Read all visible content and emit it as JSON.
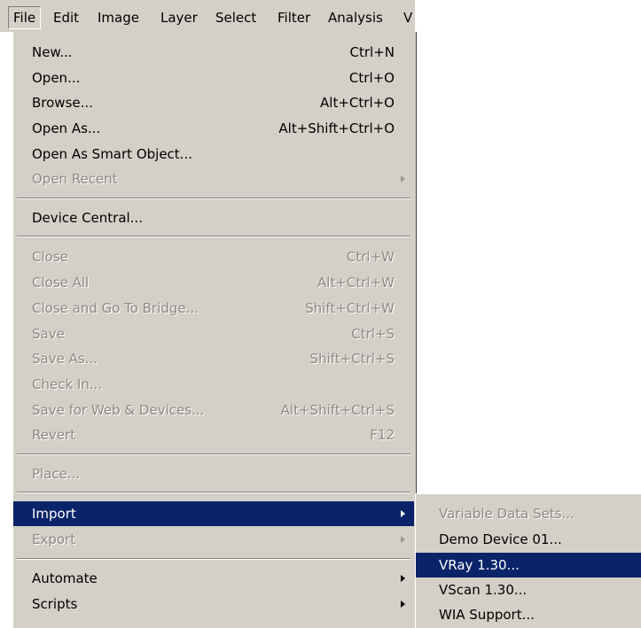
{
  "menubar": {
    "items": [
      "File",
      "Edit",
      "Image",
      "Layer",
      "Select",
      "Filter",
      "Analysis",
      "V"
    ]
  },
  "file_menu": {
    "items": [
      {
        "label": "New...",
        "shortcut": "Ctrl+N",
        "enabled": true
      },
      {
        "label": "Open...",
        "shortcut": "Ctrl+O",
        "enabled": true
      },
      {
        "label": "Browse...",
        "shortcut": "Alt+Ctrl+O",
        "enabled": true
      },
      {
        "label": "Open As...",
        "shortcut": "Alt+Shift+Ctrl+O",
        "enabled": true
      },
      {
        "label": "Open As Smart Object...",
        "shortcut": "",
        "enabled": true
      },
      {
        "label": "Open Recent",
        "shortcut": "",
        "enabled": false,
        "submenu": true
      },
      {
        "label": "Device Central...",
        "shortcut": "",
        "enabled": true
      },
      {
        "label": "Close",
        "shortcut": "Ctrl+W",
        "enabled": false
      },
      {
        "label": "Close All",
        "shortcut": "Alt+Ctrl+W",
        "enabled": false
      },
      {
        "label": "Close and Go To Bridge...",
        "shortcut": "Shift+Ctrl+W",
        "enabled": false
      },
      {
        "label": "Save",
        "shortcut": "Ctrl+S",
        "enabled": false
      },
      {
        "label": "Save As...",
        "shortcut": "Shift+Ctrl+S",
        "enabled": false
      },
      {
        "label": "Check In...",
        "shortcut": "",
        "enabled": false
      },
      {
        "label": "Save for Web & Devices...",
        "shortcut": "Alt+Shift+Ctrl+S",
        "enabled": false
      },
      {
        "label": "Revert",
        "shortcut": "F12",
        "enabled": false
      },
      {
        "label": "Place...",
        "shortcut": "",
        "enabled": false
      },
      {
        "label": "Import",
        "shortcut": "",
        "enabled": true,
        "submenu": true,
        "highlighted": true
      },
      {
        "label": "Export",
        "shortcut": "",
        "enabled": false,
        "submenu": true
      },
      {
        "label": "Automate",
        "shortcut": "",
        "enabled": true,
        "submenu": true
      },
      {
        "label": "Scripts",
        "shortcut": "",
        "enabled": true,
        "submenu": true
      }
    ]
  },
  "import_submenu": {
    "items": [
      {
        "label": "Variable Data Sets...",
        "enabled": false
      },
      {
        "label": "Demo Device 01...",
        "enabled": true
      },
      {
        "label": "VRay 1.30...",
        "enabled": true,
        "highlighted": true
      },
      {
        "label": "VScan 1.30...",
        "enabled": true
      },
      {
        "label": "WIA Support...",
        "enabled": true
      }
    ]
  },
  "colors": {
    "menu_bg": "#d4d0c8",
    "highlight_bg": "#0a246a",
    "highlight_fg": "#ffffff",
    "disabled_fg": "#8c8a84"
  }
}
